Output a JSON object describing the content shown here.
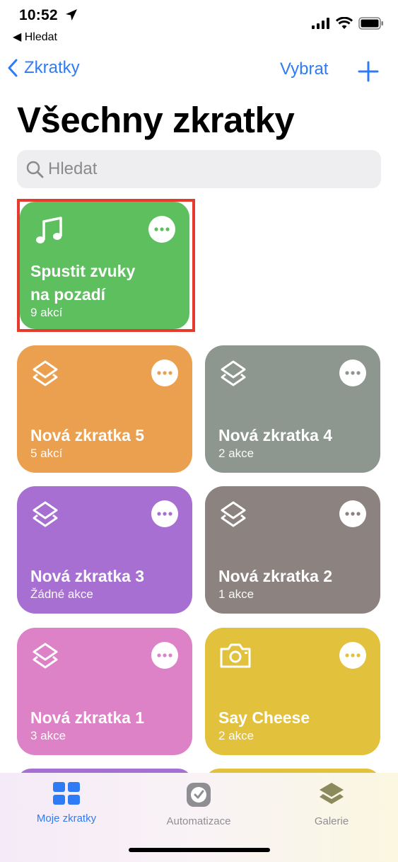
{
  "status": {
    "time": "10:52",
    "back_label": "◀ Hledat"
  },
  "nav": {
    "back_label": "Zkratky",
    "select_label": "Vybrat"
  },
  "title": "Všechny zkratky",
  "search": {
    "placeholder": "Hledat"
  },
  "shortcuts": [
    {
      "title_line1": "Spustit zvuky",
      "title_line2": "na pozadí",
      "subtitle": "9 akcí",
      "color": "#5dbf5e",
      "icon": "music-note-icon"
    },
    {
      "title_line1": "Nová zkratka 5",
      "subtitle": "5 akcí",
      "color": "#eba04f",
      "icon": "layers-icon"
    },
    {
      "title_line1": "Nová zkratka 4",
      "subtitle": "2 akce",
      "color": "#8d968f",
      "icon": "layers-icon"
    },
    {
      "title_line1": "Nová zkratka 3",
      "subtitle": "Žádné akce",
      "color": "#a76fd2",
      "icon": "layers-icon"
    },
    {
      "title_line1": "Nová zkratka 2",
      "subtitle": "1 akce",
      "color": "#8c827f",
      "icon": "layers-icon"
    },
    {
      "title_line1": "Nová zkratka 1",
      "subtitle": "3 akce",
      "color": "#dd82c6",
      "icon": "layers-icon"
    },
    {
      "title_line1": "Say Cheese",
      "subtitle": "2 akce",
      "color": "#e2c13c",
      "icon": "camera-icon"
    }
  ],
  "tabs": [
    {
      "label": "Moje zkratky",
      "color": "#2f7bf6",
      "selected": true
    },
    {
      "label": "Automatizace",
      "color": "#8e8e93",
      "selected": false
    },
    {
      "label": "Galerie",
      "color": "#8e8e93",
      "selected": false
    }
  ]
}
